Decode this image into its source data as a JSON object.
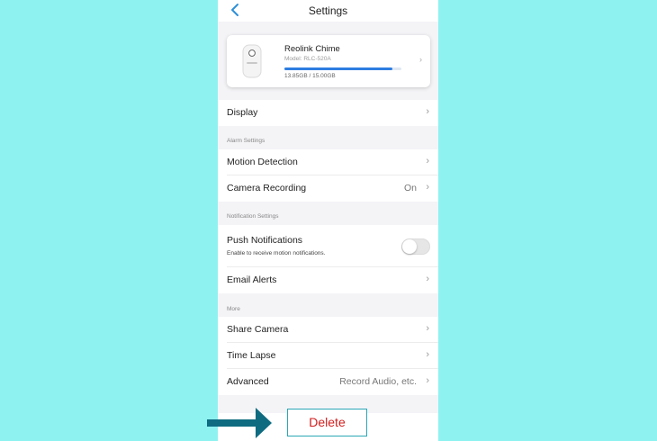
{
  "header": {
    "title": "Settings",
    "back_icon": "chevron-left-icon"
  },
  "device": {
    "name": "Reolink Chime",
    "model": "Model: RLC-520A",
    "storage": "13.85GB / 15.00GB",
    "storage_used_fraction": 0.923
  },
  "rows": {
    "display": "Display",
    "motion_detection": "Motion Detection",
    "camera_recording": "Camera Recording",
    "camera_recording_value": "On",
    "push_notifications": "Push Notifications",
    "push_notifications_sub": "Enable to receive motion notifications.",
    "push_notifications_enabled": false,
    "email_alerts": "Email Alerts",
    "share_camera": "Share Camera",
    "time_lapse": "Time Lapse",
    "advanced": "Advanced",
    "advanced_value": "Record Audio, etc."
  },
  "sections": {
    "alarm": "Alarm Settings",
    "notification": "Notification Settings",
    "more": "More"
  },
  "delete_label": "Delete",
  "colors": {
    "background": "#8ef2f0",
    "accent": "#2d8fd8",
    "delete_text": "#d21c1c",
    "arrow": "#0f6b80"
  }
}
